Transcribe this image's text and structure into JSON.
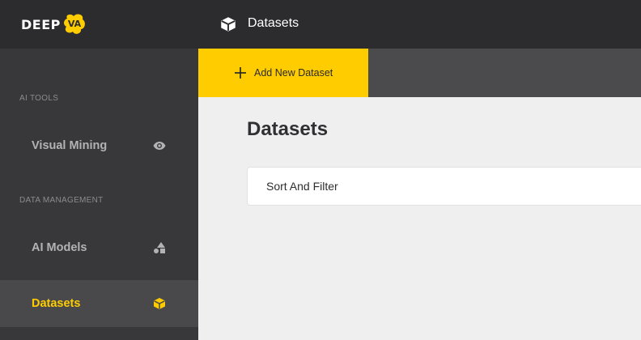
{
  "brand": {
    "logo_text": "DEEP",
    "logo_badge": "VA",
    "accent": "#ffcc00"
  },
  "sidebar": {
    "sections": [
      {
        "title": "AI TOOLS",
        "items": [
          {
            "label": "Visual Mining",
            "icon": "eye-icon",
            "active": false
          }
        ]
      },
      {
        "title": "DATA MANAGEMENT",
        "items": [
          {
            "label": "AI Models",
            "icon": "shapes-icon",
            "active": false
          },
          {
            "label": "Datasets",
            "icon": "cube-icon",
            "active": true
          }
        ]
      }
    ]
  },
  "header": {
    "title": "Datasets",
    "icon": "cube-icon"
  },
  "toolbar": {
    "add_label": "Add New Dataset",
    "add_icon": "plus-icon"
  },
  "main": {
    "title": "Datasets",
    "sort_filter_label": "Sort And Filter"
  }
}
